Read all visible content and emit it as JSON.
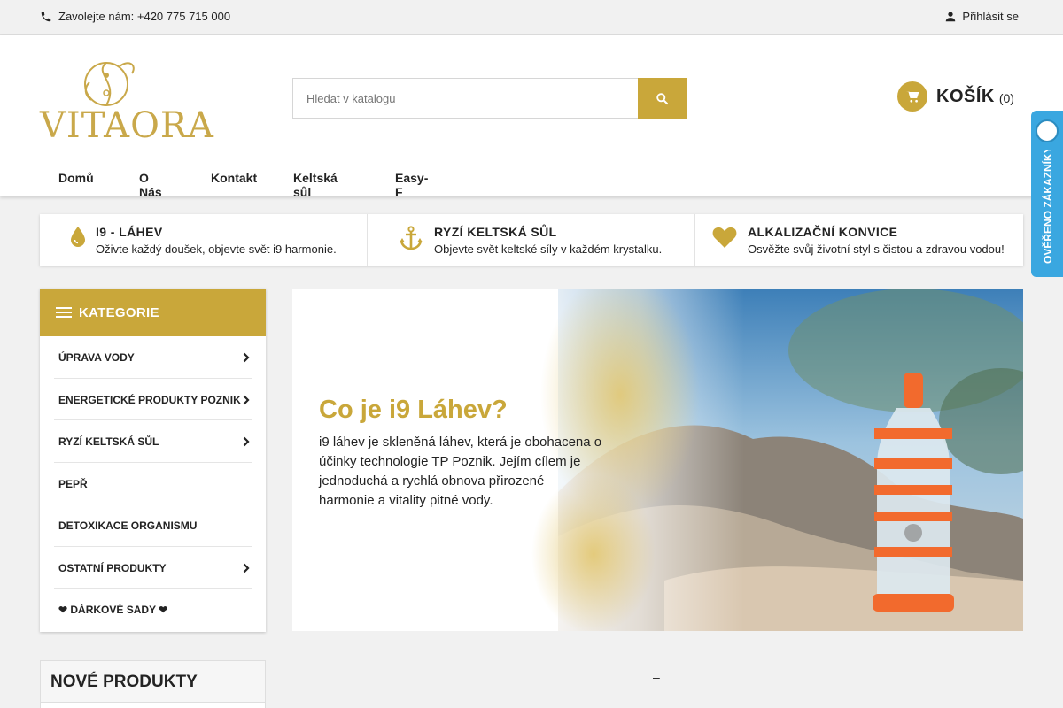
{
  "topbar": {
    "contact_text": "Zavolejte nám: +420 775 715 000",
    "login_label": "Přihlásit se"
  },
  "header": {
    "logo_text": "VITAORA",
    "search": {
      "placeholder": "Hledat v katalogu"
    },
    "cart": {
      "label": "KOŠÍK",
      "count": "(0)"
    }
  },
  "nav": {
    "items": [
      {
        "label": "Domů"
      },
      {
        "label": "O Nás"
      },
      {
        "label": "Kontakt"
      },
      {
        "label": "Keltská sůl"
      },
      {
        "label": "Easy-F"
      }
    ]
  },
  "badge": {
    "text": "OVĚŘENO ZÁKAZNÍKY"
  },
  "infostrip": {
    "items": [
      {
        "title": "I9 - LÁHEV",
        "subtitle": "Oživte každý doušek, objevte svět i9 harmonie.",
        "icon": "drop-icon"
      },
      {
        "title": "RYZÍ KELTSKÁ SŮL",
        "subtitle": "Objevte svět keltské síly v každém krystalku.",
        "icon": "anchor-icon"
      },
      {
        "title": "ALKALIZAČNÍ KONVICE",
        "subtitle": "Osvěžte svůj životní styl s čistou a zdravou vodou!",
        "icon": "heart-icon"
      }
    ]
  },
  "categories": {
    "heading": "KATEGORIE",
    "items": [
      {
        "label": "ÚPRAVA VODY",
        "has_children": true
      },
      {
        "label": "ENERGETICKÉ PRODUKTY POZNIK",
        "has_children": true
      },
      {
        "label": "RYZÍ KELTSKÁ SŮL",
        "has_children": true
      },
      {
        "label": "PEPŘ",
        "has_children": false
      },
      {
        "label": "DETOXIKACE ORGANISMU",
        "has_children": false
      },
      {
        "label": "OSTATNÍ PRODUKTY",
        "has_children": true
      },
      {
        "label": "❤ DÁRKOVÉ SADY ❤",
        "has_children": false
      }
    ]
  },
  "banner": {
    "title": "Co je i9 Láhev?",
    "text": "i9 láhev je skleněná láhev, která je obohacena o účinky technologie TP Poznik. Jejím cílem je jednoduchá a rychlá obnova přirozené harmonie a vitality pitné vody."
  },
  "slider_indicator": "–",
  "new_products": {
    "heading": "NOVÉ PRODUKTY"
  },
  "colors": {
    "accent": "#c9a73a",
    "badge": "#3aa7e0"
  }
}
